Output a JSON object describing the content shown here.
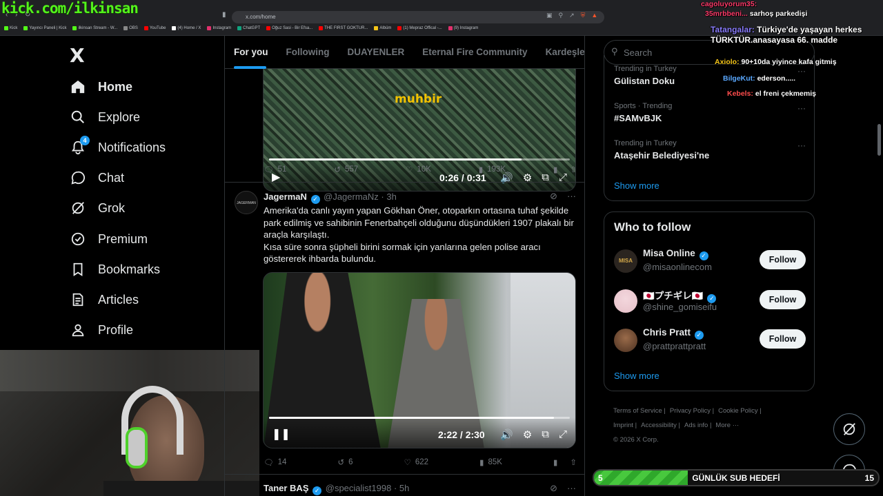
{
  "stream_overlay": {
    "title": "kick.com/ilkinsan"
  },
  "browser": {
    "url": "x.com/home",
    "bookmarks": [
      "Kick",
      "Yayıncı Paneli | Kick",
      "ilkinsan Stream - W...",
      "OBS",
      "YouTube",
      "(4) Home / X",
      "Instagram",
      "ChatGPT",
      "Oğuz Sasi - Bir Efsa...",
      "THE FIRST GOKTUR...",
      "Albüm",
      "(1) Mepraz Offical -...",
      "(9) Instagram"
    ],
    "bookmark_colors": [
      "#53fc18",
      "#53fc18",
      "#53fc18",
      "#888888",
      "#ff0000",
      "#ffffff",
      "#e1306c",
      "#10a37f",
      "#ff0000",
      "#ff0000",
      "#f5c518",
      "#ff0000",
      "#e1306c"
    ]
  },
  "nav": {
    "logo": "X",
    "items": [
      {
        "label": "Home",
        "icon": "home-icon"
      },
      {
        "label": "Explore",
        "icon": "search-icon"
      },
      {
        "label": "Notifications",
        "icon": "bell-icon",
        "badge": "4"
      },
      {
        "label": "Chat",
        "icon": "chat-icon"
      },
      {
        "label": "Grok",
        "icon": "grok-icon"
      },
      {
        "label": "Premium",
        "icon": "premium-icon"
      },
      {
        "label": "Bookmarks",
        "icon": "bookmark-icon"
      },
      {
        "label": "Articles",
        "icon": "articles-icon"
      },
      {
        "label": "Profile",
        "icon": "profile-icon"
      }
    ]
  },
  "feed": {
    "tabs": [
      "For you",
      "Following",
      "DUAYENLER",
      "Eternal Fire Community",
      "Kardeşler Kı"
    ],
    "post1": {
      "video_brand": "muhbir",
      "time": "0:26 / 0:31",
      "progress": 0.84,
      "replies": "51",
      "reposts": "557",
      "likes": "10K",
      "views": "193K"
    },
    "post2": {
      "name": "JagermaN",
      "handle": "@JagermaNz",
      "time": "3h",
      "avatar_text": "JAGERMAN",
      "text": "Amerika'da canlı yayın yapan Gökhan Öner, otoparkın ortasına tuhaf şekilde park edilmiş ve sahibinin Fenerbahçeli olduğunu düşündükleri 1907 plakalı bir araçla karşılaştı.\nKısa süre sonra şüpheli birini sormak için yanlarına gelen polise aracı göstererek ihbarda bulundu.",
      "video_time": "2:22 / 2:30",
      "progress": 0.947,
      "replies": "14",
      "reposts": "6",
      "likes": "622",
      "views": "85K"
    },
    "post3": {
      "name": "Taner BAŞ",
      "handle": "@specialist1998",
      "time": "5h"
    }
  },
  "sidebar": {
    "search_placeholder": "Search",
    "trends": [
      {
        "context": "Trending in Turkey",
        "title": "Gülistan Doku"
      },
      {
        "context": "Sports · Trending",
        "title": "#SAMvBJK"
      },
      {
        "context": "Trending in Turkey",
        "title": "Ataşehir Belediyesi'ne"
      }
    ],
    "show_more": "Show more",
    "who_to_follow": {
      "title": "Who to follow",
      "accounts": [
        {
          "name": "Misa Online",
          "handle": "@misaonlinecom",
          "avatar_text": "MISA"
        },
        {
          "name": "🇯🇵プチギレ🇯🇵",
          "handle": "@shine_gomiseifu",
          "avatar_text": ""
        },
        {
          "name": "Chris Pratt",
          "handle": "@prattprattpratt",
          "avatar_text": ""
        }
      ],
      "follow_label": "Follow",
      "show_more": "Show more"
    },
    "footer": [
      "Terms of Service",
      "Privacy Policy",
      "Cookie Policy",
      "Imprint",
      "Accessibility",
      "Ads info",
      "More ···",
      "© 2026 X Corp."
    ]
  },
  "chat_overlay": [
    {
      "user": "cagoluyorum35:",
      "msg": "",
      "color": "#ff3b6b"
    },
    {
      "user": "35mrbbeni...",
      "msg": "sarhoş parkedişi",
      "color": "#ff3b6b"
    },
    {
      "user": "Tatangalar:",
      "msg": "Türkiye'de yaşayan herkes TÜRKTÜR.anasayasa 66. madde",
      "color": "#8a7dff"
    },
    {
      "user": "Axiolo:",
      "msg": "90+10da yiyince kafa gitmiş",
      "color": "#f5c518"
    },
    {
      "user": "BilgeKut:",
      "msg": "ederson.....",
      "color": "#5aa8ff"
    },
    {
      "user": "Kebels:",
      "msg": "el freni çekmemiş",
      "color": "#ff4d4d"
    }
  ],
  "sub_goal": {
    "label": "GÜNLÜK SUB HEDEFİ",
    "current": "5",
    "goal": "15",
    "progress": 0.33
  },
  "colors": {
    "accent": "#1d9bf0",
    "stream_green": "#54f21b",
    "background": "#000000"
  }
}
